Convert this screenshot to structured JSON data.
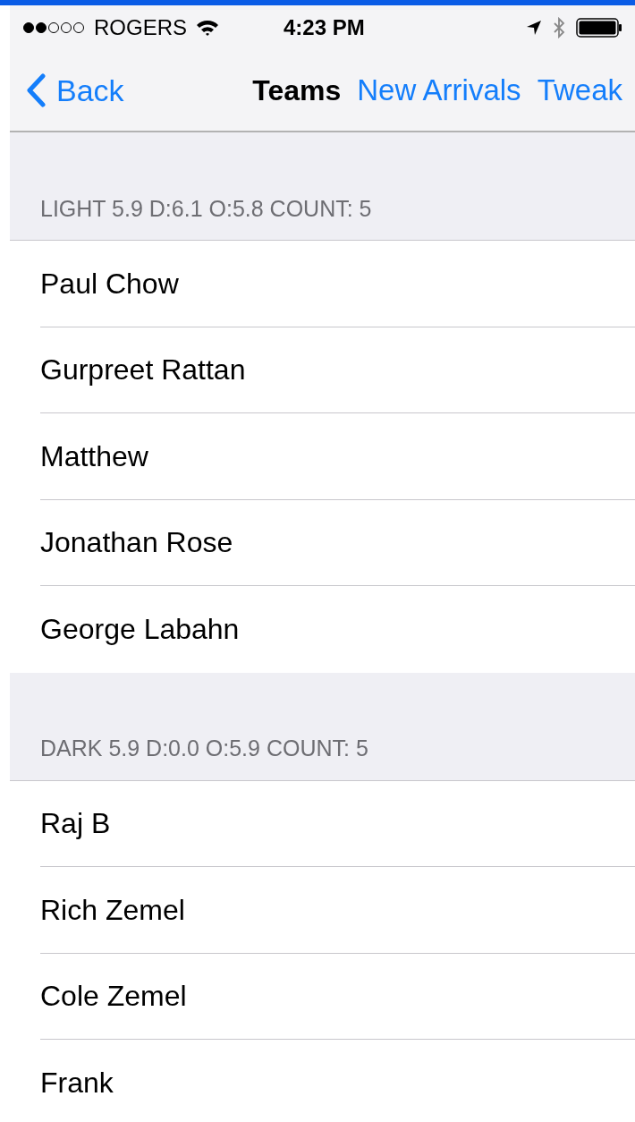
{
  "status_bar": {
    "carrier": "ROGERS",
    "time": "4:23 PM"
  },
  "nav": {
    "back": "Back",
    "title": "Teams",
    "actions": [
      "New Arrivals",
      "Tweak"
    ]
  },
  "sections": [
    {
      "header": "LIGHT 5.9 D:6.1 O:5.8 COUNT: 5",
      "rows": [
        "Paul Chow",
        "Gurpreet Rattan",
        "Matthew",
        "Jonathan Rose",
        "George Labahn"
      ]
    },
    {
      "header": "DARK 5.9 D:0.0 O:5.9 COUNT: 5",
      "rows": [
        "Raj B",
        "Rich Zemel",
        "Cole Zemel",
        "Frank"
      ]
    }
  ]
}
